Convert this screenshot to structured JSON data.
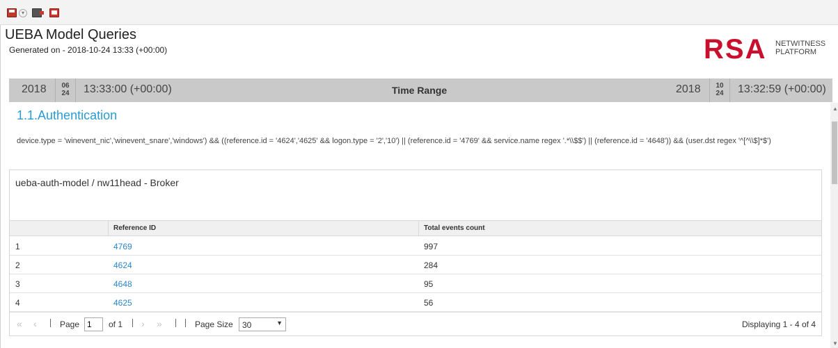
{
  "toolbar": {
    "buttons": [
      "save-icon",
      "dropdown-icon",
      "export-icon",
      "close-icon"
    ]
  },
  "header": {
    "title": "UEBA Model Queries",
    "generated": "Generated on - 2018-10-24 13:33 (+00:00)",
    "logo": {
      "brand": "RSA",
      "line1": "NETWITNESS",
      "line2": "PLATFORM"
    }
  },
  "time_range": {
    "label": "Time Range",
    "start": {
      "year": "2018",
      "month": "06",
      "day": "24",
      "time": "13:33:00 (+00:00)"
    },
    "end": {
      "year": "2018",
      "month": "10",
      "day": "24",
      "time": "13:32:59 (+00:00)"
    }
  },
  "section": {
    "title": "1.1.Authentication",
    "query": "device.type = 'winevent_nic','winevent_snare','windows') && ((reference.id = '4624','4625' && logon.type = '2','10') || (reference.id = '4769' && service.name regex '.*\\\\$$') || (reference.id = '4648')) && (user.dst regex '^[^\\\\$]*$')"
  },
  "panel": {
    "title": "ueba-auth-model / nw11head - Broker",
    "columns": [
      "",
      "Reference ID",
      "Total events count"
    ],
    "rows": [
      {
        "num": "1",
        "ref": "4769",
        "count": "997"
      },
      {
        "num": "2",
        "ref": "4624",
        "count": "284"
      },
      {
        "num": "3",
        "ref": "4648",
        "count": "95"
      },
      {
        "num": "4",
        "ref": "4625",
        "count": "56"
      }
    ]
  },
  "pager": {
    "page_label": "Page",
    "page_value": "1",
    "of_label": "of 1",
    "size_label": "Page Size",
    "size_value": "30",
    "display": "Displaying 1 - 4 of 4"
  },
  "colors": {
    "accent": "#2c9ad1",
    "link": "#2c86c8",
    "brand": "#c8102e",
    "timebar": "#c9c9c9"
  }
}
